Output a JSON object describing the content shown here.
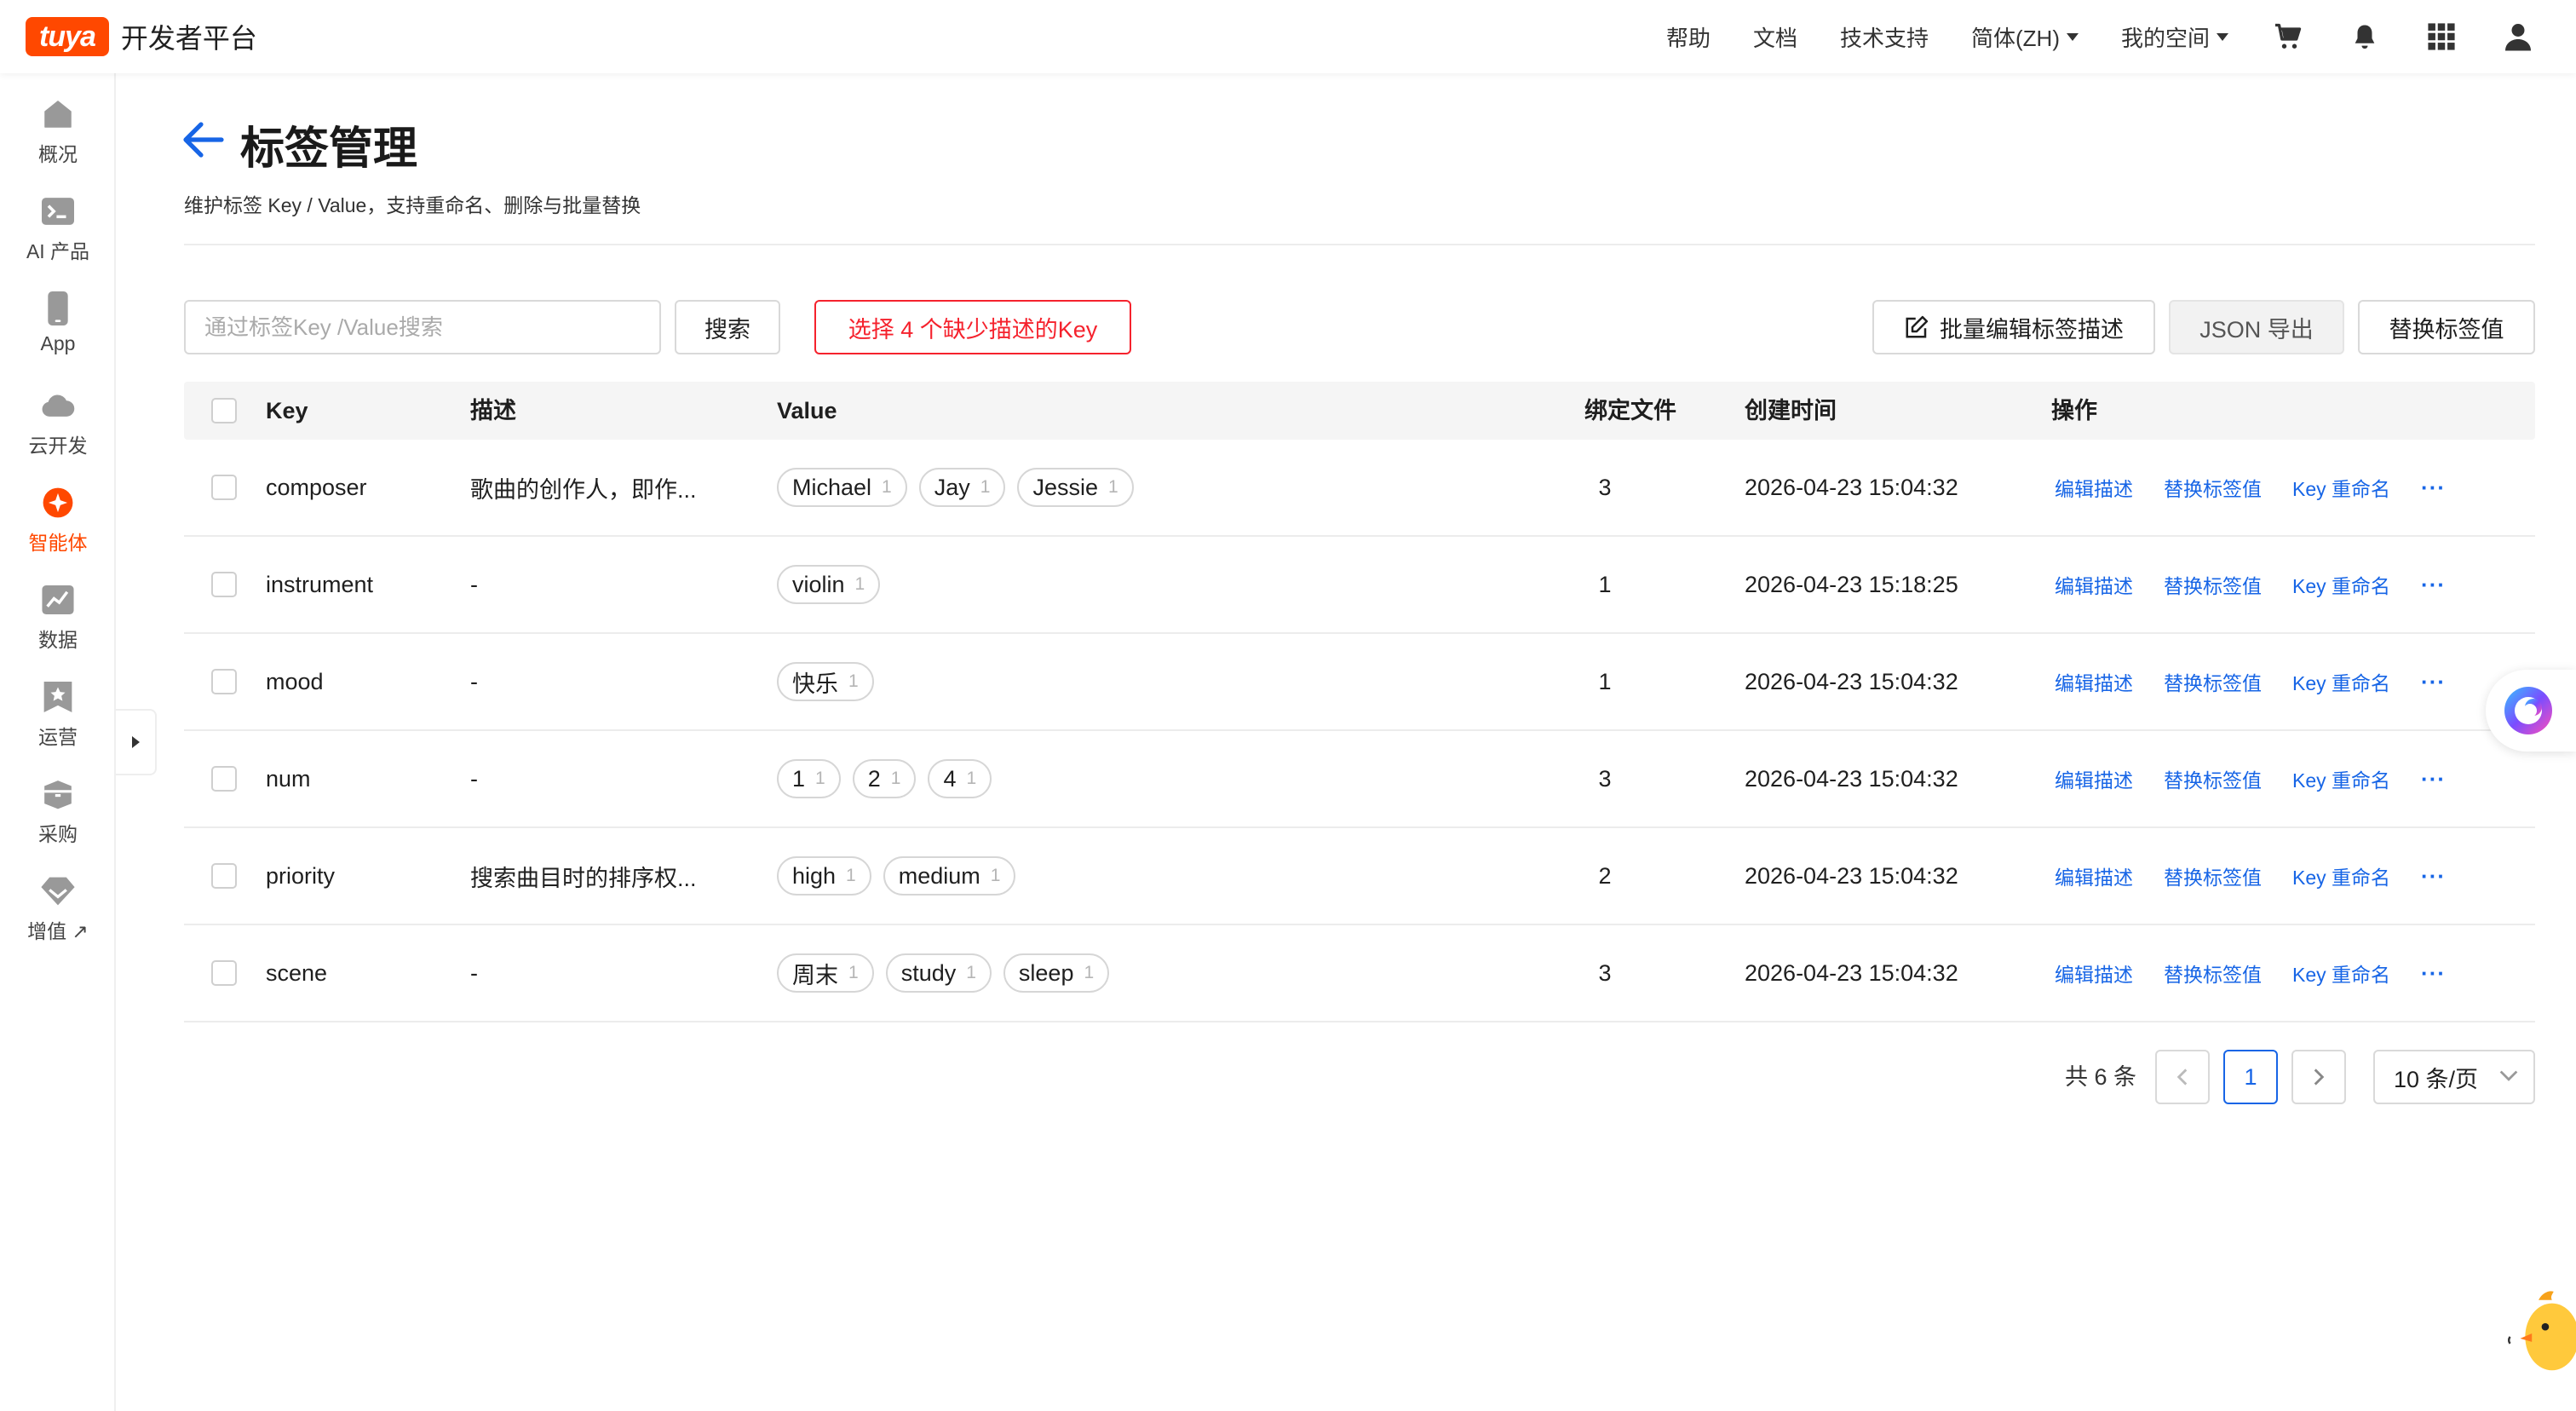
{
  "brand": {
    "logo": "tuya",
    "name": "开发者平台"
  },
  "topnav": {
    "links": [
      "帮助",
      "文档",
      "技术支持"
    ],
    "language": "简体(ZH)",
    "workspace": "我的空间",
    "icons": [
      "cart-icon",
      "bell-icon",
      "apps-grid-icon",
      "user-icon"
    ]
  },
  "sidebar": {
    "items": [
      {
        "label": "概况",
        "icon": "home-icon"
      },
      {
        "label": "AI 产品",
        "icon": "terminal-icon"
      },
      {
        "label": "App",
        "icon": "phone-icon"
      },
      {
        "label": "云开发",
        "icon": "cloud-icon"
      },
      {
        "label": "智能体",
        "icon": "agent-icon",
        "active": true
      },
      {
        "label": "数据",
        "icon": "chart-icon"
      },
      {
        "label": "运营",
        "icon": "star-badge-icon"
      },
      {
        "label": "采购",
        "icon": "box-icon"
      },
      {
        "label": "增值",
        "icon": "diamond-icon",
        "suffix": "↗"
      }
    ]
  },
  "header": {
    "title": "标签管理",
    "subtitle": "维护标签 Key / Value，支持重命名、删除与批量替换"
  },
  "toolbar": {
    "search_placeholder": "通过标签Key /Value搜索",
    "search_value": "",
    "search_button": "搜索",
    "missing_desc_button": "选择 4 个缺少描述的Key",
    "batch_edit_button": "批量编辑标签描述",
    "json_export_button": "JSON 导出",
    "replace_button": "替换标签值"
  },
  "table": {
    "columns": {
      "key": "Key",
      "desc": "描述",
      "value": "Value",
      "files": "绑定文件",
      "created": "创建时间",
      "ops": "操作"
    },
    "op_labels": {
      "edit_desc": "编辑描述",
      "replace_value": "替换标签值",
      "rename_key": "Key 重命名",
      "more": "···"
    },
    "rows": [
      {
        "key": "composer",
        "desc": "歌曲的创作人，即作...",
        "values": [
          {
            "v": "Michael",
            "n": "1"
          },
          {
            "v": "Jay",
            "n": "1"
          },
          {
            "v": "Jessie",
            "n": "1"
          }
        ],
        "files": "3",
        "created": "2026-04-23 15:04:32"
      },
      {
        "key": "instrument",
        "desc": "-",
        "values": [
          {
            "v": "violin",
            "n": "1"
          }
        ],
        "files": "1",
        "created": "2026-04-23 15:18:25"
      },
      {
        "key": "mood",
        "desc": "-",
        "values": [
          {
            "v": "快乐",
            "n": "1"
          }
        ],
        "files": "1",
        "created": "2026-04-23 15:04:32"
      },
      {
        "key": "num",
        "desc": "-",
        "values": [
          {
            "v": "1",
            "n": "1"
          },
          {
            "v": "2",
            "n": "1"
          },
          {
            "v": "4",
            "n": "1"
          }
        ],
        "files": "3",
        "created": "2026-04-23 15:04:32"
      },
      {
        "key": "priority",
        "desc": "搜索曲目时的排序权...",
        "values": [
          {
            "v": "high",
            "n": "1"
          },
          {
            "v": "medium",
            "n": "1"
          }
        ],
        "files": "2",
        "created": "2026-04-23 15:04:32"
      },
      {
        "key": "scene",
        "desc": "-",
        "values": [
          {
            "v": "周末",
            "n": "1"
          },
          {
            "v": "study",
            "n": "1"
          },
          {
            "v": "sleep",
            "n": "1"
          }
        ],
        "files": "3",
        "created": "2026-04-23 15:04:32"
      }
    ]
  },
  "pagination": {
    "total": "共 6 条",
    "prev": "<",
    "current": "1",
    "next": ">",
    "page_size": "10 条/页"
  },
  "colors": {
    "brand": "#ff4800",
    "link": "#1765e6",
    "danger": "#f5222d"
  }
}
